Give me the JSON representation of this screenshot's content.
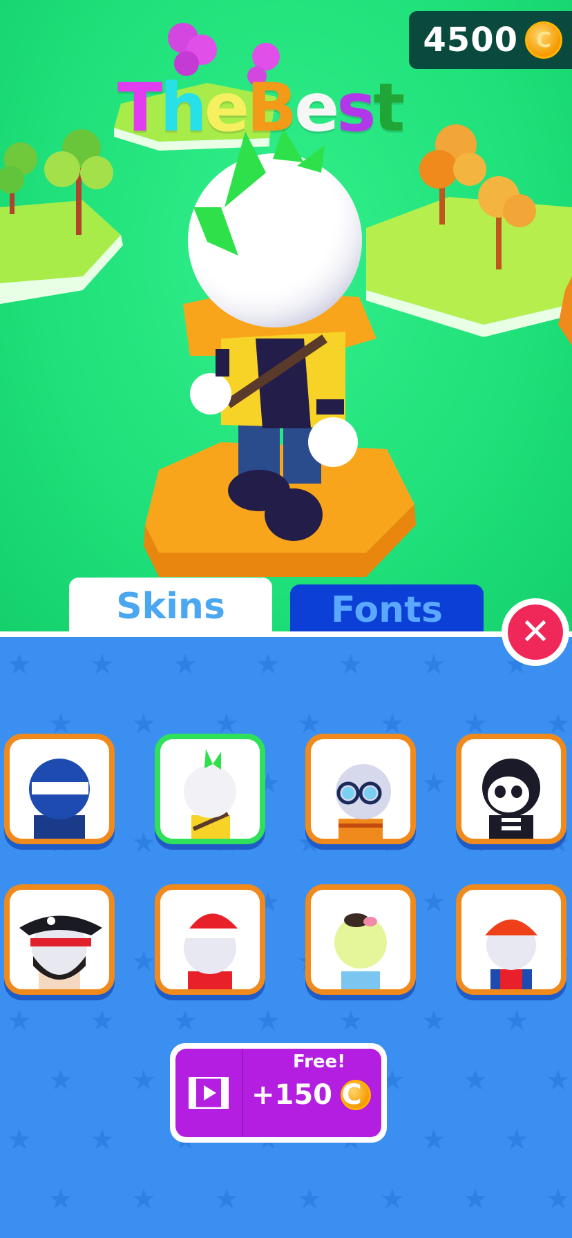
{
  "coins": {
    "value": "4500",
    "icon": "coin-icon",
    "coin_letter": "C"
  },
  "title": {
    "letters": [
      "T",
      "h",
      "e",
      "B",
      "e",
      "s",
      "t"
    ],
    "colors": [
      "#e13cf0",
      "#27e0e8",
      "#f4f060",
      "#f39a18",
      "#f6f6f6",
      "#b137e8",
      "#21a536"
    ]
  },
  "tabs": {
    "skins": "Skins",
    "fonts": "Fonts"
  },
  "close": {
    "icon": "close-icon",
    "glyph": "✕"
  },
  "skins": [
    {
      "name": "ninja"
    },
    {
      "name": "punk",
      "selected": true
    },
    {
      "name": "scientist"
    },
    {
      "name": "skeleton"
    },
    {
      "name": "pirate"
    },
    {
      "name": "santa"
    },
    {
      "name": "zombie"
    },
    {
      "name": "red-cap"
    }
  ],
  "reward": {
    "label": "Free!",
    "amount": "+150",
    "icon": "video-icon",
    "coin_letter": "C"
  },
  "colors": {
    "scene": "#1fe07a",
    "panel": "#3a8ff0",
    "skin_border": "#f08a1c",
    "skin_selected": "#2ee05a",
    "reward": "#b41ee0",
    "close": "#f0285a"
  }
}
